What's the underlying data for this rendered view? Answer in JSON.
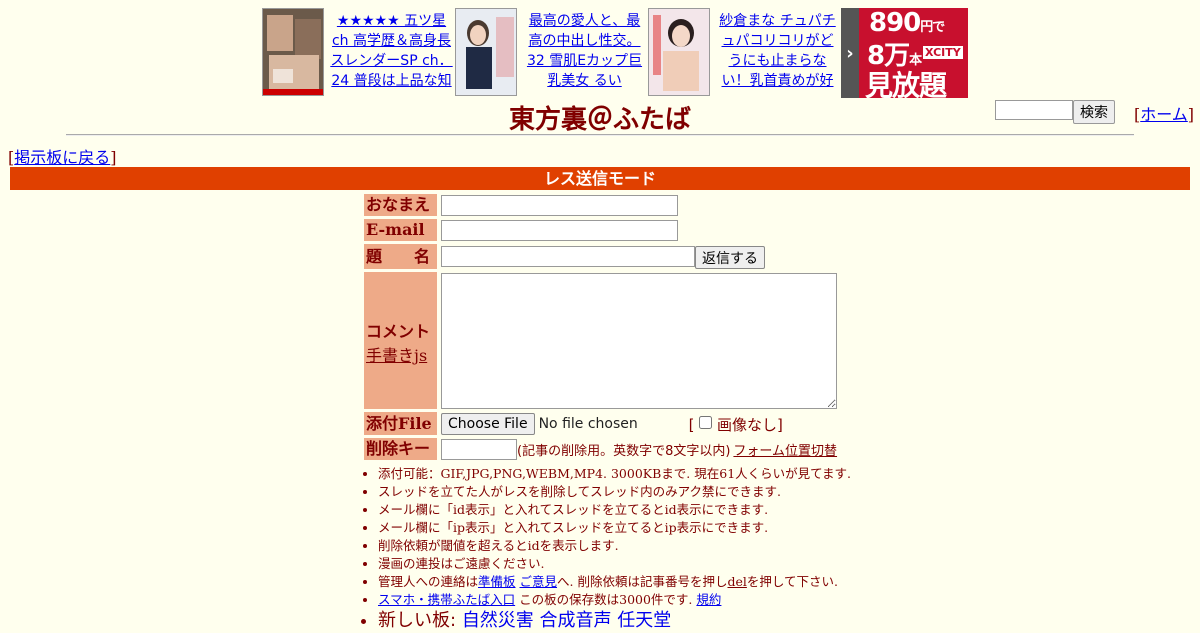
{
  "ads": [
    {
      "text": "★★★★★ 五ツ星ch 高学歴＆高身長スレンダーSP ch．24 普段は上品な知"
    },
    {
      "text": "最高の愛人と、最高の中出し性交。 32 雪肌Eカップ巨乳美女 るい"
    },
    {
      "text": "紗倉まな チュパチュパコリコリがどうにも止まらない！乳首責めが好"
    }
  ],
  "promo": {
    "line1": "890",
    "line1_unit": "円で",
    "line2": "8万",
    "line2_unit": "本",
    "logo": "XCITY",
    "line3": "見放題"
  },
  "header": {
    "title": "東方裏＠ふたば",
    "search_button": "検索",
    "home_link": "ホーム",
    "back_link": "掲示板に戻る"
  },
  "mode_bar": "レス送信モード",
  "form": {
    "name_label": "おなまえ",
    "email_label": "E-mail",
    "subject_label": "題　　名",
    "submit_button": "返信する",
    "comment_label": "コメント",
    "handwriting_link": "手書きjs",
    "file_label": "添付File",
    "choose_file_button": "Choose File",
    "no_file_text": "No file chosen",
    "no_image_label": "画像なし",
    "delete_key_label": "削除キー",
    "delete_key_note": "(記事の削除用。英数字で8文字以内)",
    "form_position_link": "フォーム位置切替"
  },
  "rules": [
    "添付可能：GIF,JPG,PNG,WEBM,MP4. 3000KBまで. 現在61人くらいが見てます.",
    "スレッドを立てた人がレスを削除してスレッド内のみアク禁にできます.",
    "メール欄に「id表示」と入れてスレッドを立てるとid表示にできます.",
    "メール欄に「ip表示」と入れてスレッドを立てるとip表示にできます.",
    "削除依頼が閾値を超えるとidを表示します.",
    "漫画の連投はご遠慮ください."
  ],
  "contact": {
    "prefix": "管理人への連絡は",
    "link1": "準備板",
    "link2": "ご意見",
    "middle": "へ. 削除依頼は記事番号を押し",
    "del": "del",
    "suffix": "を押して下さい."
  },
  "mobile": {
    "link": "スマホ・携帯ふたば入口",
    "text": "この板の保存数は3000件です.",
    "terms": "規約"
  },
  "new_boards": {
    "label": "新しい板:",
    "boards": [
      "自然災害",
      "合成音声",
      "任天堂"
    ]
  },
  "colors": {
    "background": "#FFFFEE",
    "text": "#800000",
    "label_bg": "#EEAA88",
    "mode_bar": "#E04000",
    "promo": "#C8102E"
  }
}
